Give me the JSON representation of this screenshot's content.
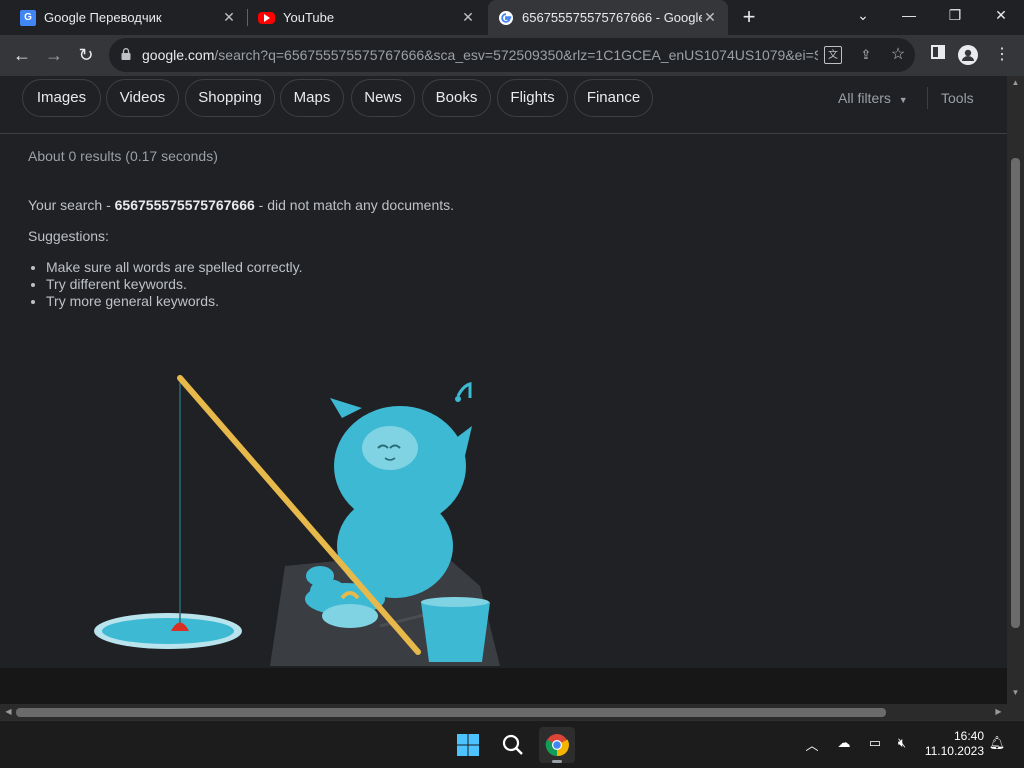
{
  "browser": {
    "tabs": [
      {
        "title": "Google Переводчик",
        "icon": "google-translate-icon"
      },
      {
        "title": "YouTube",
        "icon": "youtube-icon"
      },
      {
        "title": "656755575575767666 - Google",
        "icon": "google-icon",
        "active": true
      }
    ],
    "url_host": "google.com",
    "url_rest": "/search?q=656755575575767666&sca_esv=572509350&rlz=1C1GCEA_enUS1074US1079&ei=S..."
  },
  "filters": {
    "chips": [
      "Images",
      "Videos",
      "Shopping",
      "Maps",
      "News",
      "Books",
      "Flights",
      "Finance"
    ],
    "all_filters": "All filters",
    "tools": "Tools"
  },
  "results": {
    "stats": "About 0 results (0.17 seconds)",
    "nomatch_prefix": "Your search - ",
    "query": "656755575575767666",
    "nomatch_suffix": " - did not match any documents.",
    "suggestions_title": "Suggestions:",
    "suggestions": [
      "Make sure all words are spelled correctly.",
      "Try different keywords.",
      "Try more general keywords."
    ]
  },
  "taskbar": {
    "time": "16:40",
    "date": "11.10.2023"
  },
  "colors": {
    "background": "#202124",
    "toolbar": "#35363a",
    "illustration_teal": "#3db9d3",
    "rod_yellow": "#e6b94a",
    "float_red": "#d93025"
  }
}
